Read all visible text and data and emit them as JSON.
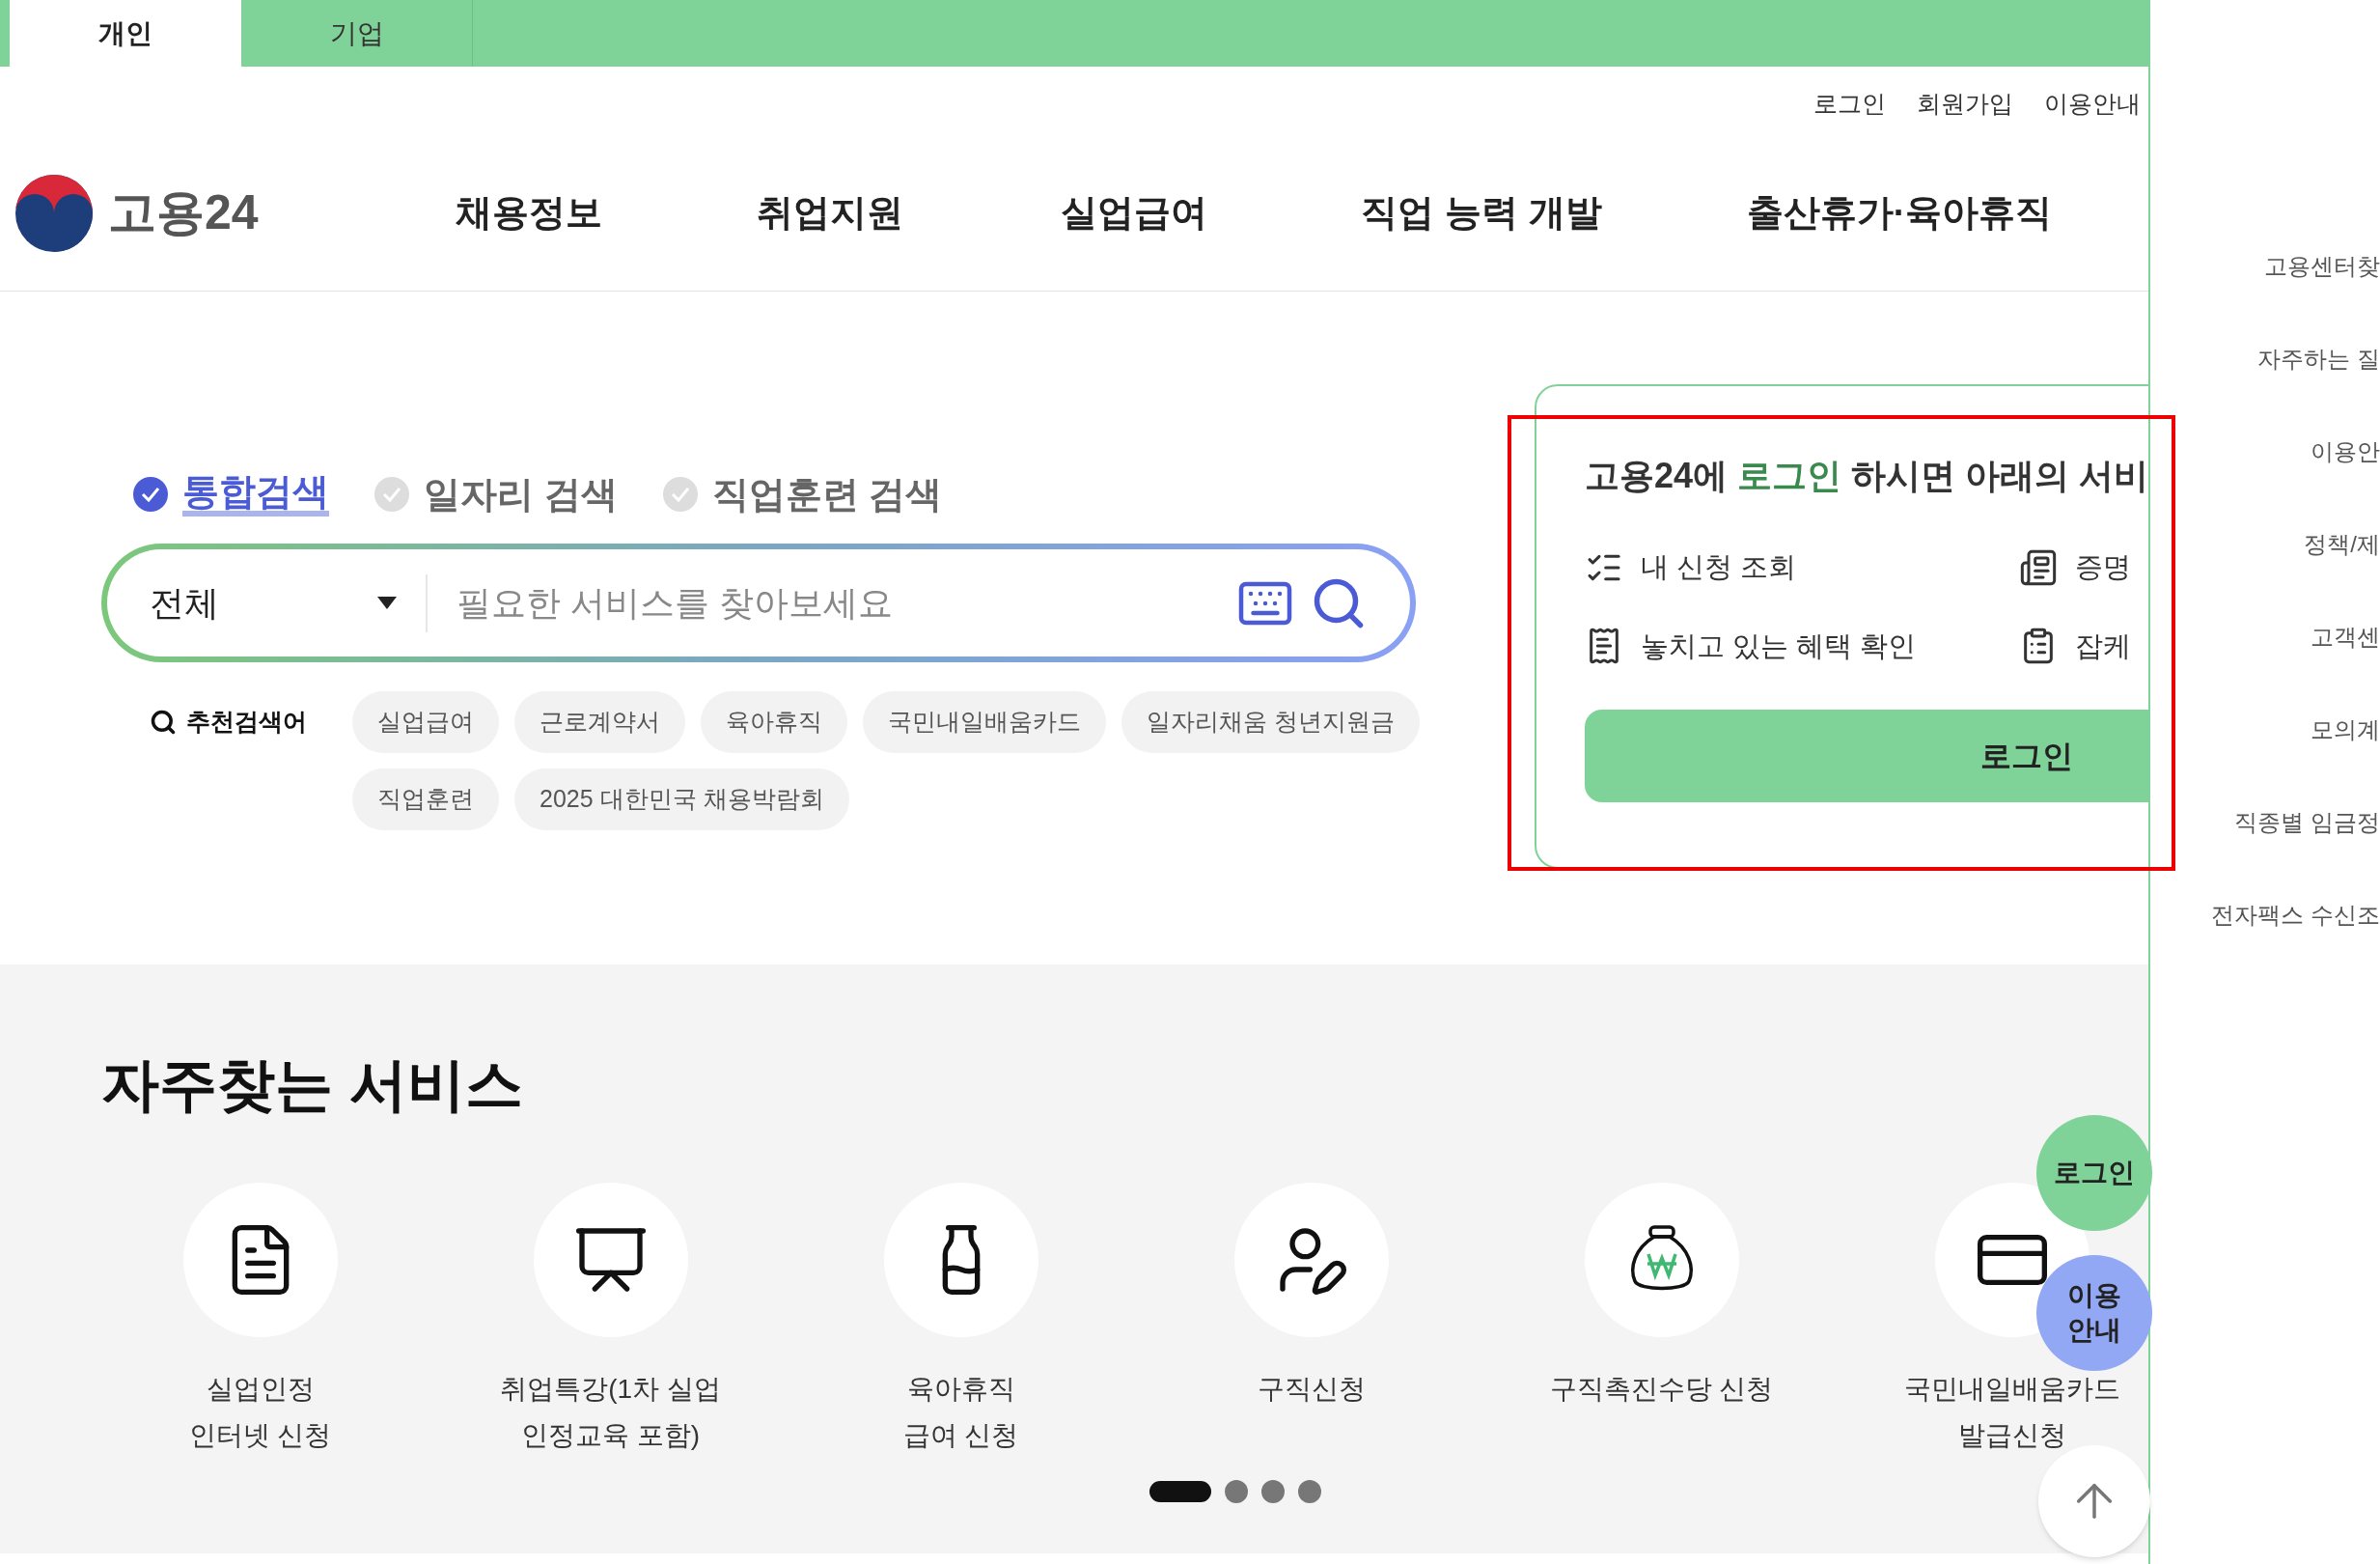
{
  "top_tabs": [
    {
      "label": "개인",
      "selected": true
    },
    {
      "label": "기업",
      "selected": false
    }
  ],
  "utility_links": [
    "로그인",
    "회원가입",
    "이용안내"
  ],
  "logo": {
    "text": "고용24"
  },
  "nav": [
    "채용정보",
    "취업지원",
    "실업급여",
    "직업 능력 개발",
    "출산휴가·육아휴직"
  ],
  "search": {
    "tabs": [
      {
        "label": "통합검색",
        "selected": true
      },
      {
        "label": "일자리 검색",
        "selected": false
      },
      {
        "label": "직업훈련 검색",
        "selected": false
      }
    ],
    "category": "전체",
    "placeholder": "필요한 서비스를 찾아보세요",
    "recommended_label": "추천검색어",
    "recommended": [
      "실업급여",
      "근로계약서",
      "육아휴직",
      "국민내일배움카드",
      "일자리채움 청년지원금",
      "직업훈련",
      "2025 대한민국 채용박람회"
    ]
  },
  "login_card": {
    "title_before": "고용24에",
    "title_link": "로그인",
    "title_after": "하시면 아래의 서비",
    "items": [
      "내 신청 조회",
      "증명",
      "놓치고 있는 혜택 확인",
      "잡케"
    ],
    "button": "로그인"
  },
  "services": {
    "title": "자주찾는 서비스",
    "items": [
      {
        "lines": [
          "실업인정",
          "인터넷 신청"
        ]
      },
      {
        "lines": [
          "취업특강(1차 실업",
          "인정교육 포함)"
        ]
      },
      {
        "lines": [
          "육아휴직",
          "급여 신청"
        ]
      },
      {
        "lines": [
          "구직신청"
        ]
      },
      {
        "lines": [
          "구직촉진수당 신청"
        ]
      },
      {
        "lines": [
          "국민내일배움카드",
          "발급신청"
        ]
      }
    ],
    "pages": [
      {
        "selected": true
      },
      {
        "selected": false
      },
      {
        "selected": false
      },
      {
        "selected": false
      }
    ]
  },
  "side_menu": [
    "고용센터찾",
    "자주하는 질",
    "이용안",
    "정책/제",
    "고객센",
    "모의계",
    "직종별 임금정",
    "전자팩스 수신조"
  ],
  "floating": {
    "login": "로그인",
    "guide": [
      "이용",
      "안내"
    ]
  }
}
